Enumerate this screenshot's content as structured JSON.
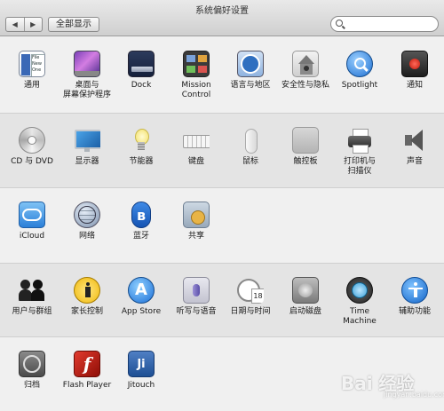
{
  "window": {
    "title": "系统偏好设置",
    "nav_back": "◀",
    "nav_forward": "▶",
    "show_all": "全部显示",
    "search_value": ""
  },
  "sections": [
    {
      "items": [
        {
          "label": "通用",
          "icon": "general-icon"
        },
        {
          "label": "桌面与\n屏幕保护程序",
          "icon": "desktop-icon"
        },
        {
          "label": "Dock",
          "icon": "dock-icon"
        },
        {
          "label": "Mission\nControl",
          "icon": "mission-control-icon"
        },
        {
          "label": "语言与地区",
          "icon": "language-icon"
        },
        {
          "label": "安全性与隐私",
          "icon": "security-icon"
        },
        {
          "label": "Spotlight",
          "icon": "spotlight-icon"
        },
        {
          "label": "通知",
          "icon": "notifications-icon"
        }
      ]
    },
    {
      "items": [
        {
          "label": "CD 与 DVD",
          "icon": "cd-icon"
        },
        {
          "label": "显示器",
          "icon": "display-icon"
        },
        {
          "label": "节能器",
          "icon": "energy-saver-icon"
        },
        {
          "label": "键盘",
          "icon": "keyboard-icon"
        },
        {
          "label": "鼠标",
          "icon": "mouse-icon"
        },
        {
          "label": "触控板",
          "icon": "trackpad-icon"
        },
        {
          "label": "打印机与\n扫描仪",
          "icon": "printer-icon"
        },
        {
          "label": "声音",
          "icon": "sound-icon"
        }
      ]
    },
    {
      "items": [
        {
          "label": "iCloud",
          "icon": "icloud-icon"
        },
        {
          "label": "网络",
          "icon": "network-icon"
        },
        {
          "label": "蓝牙",
          "icon": "bluetooth-icon"
        },
        {
          "label": "共享",
          "icon": "sharing-icon"
        }
      ]
    },
    {
      "items": [
        {
          "label": "用户与群组",
          "icon": "users-icon"
        },
        {
          "label": "家长控制",
          "icon": "parental-controls-icon"
        },
        {
          "label": "App Store",
          "icon": "app-store-icon"
        },
        {
          "label": "听写与语音",
          "icon": "dictation-icon"
        },
        {
          "label": "日期与时间",
          "icon": "date-time-icon"
        },
        {
          "label": "启动磁盘",
          "icon": "startup-disk-icon"
        },
        {
          "label": "Time Machine",
          "icon": "time-machine-icon"
        },
        {
          "label": "辅助功能",
          "icon": "accessibility-icon"
        }
      ]
    },
    {
      "items": [
        {
          "label": "归档",
          "icon": "archive-icon"
        },
        {
          "label": "Flash Player",
          "icon": "flash-player-icon"
        },
        {
          "label": "Jitouch",
          "icon": "jitouch-icon"
        }
      ]
    }
  ],
  "icon_text": {
    "date_day": "18",
    "flash_letter": "f",
    "jitouch_letters": "Ji",
    "general_lines": [
      "File",
      "New",
      "One"
    ]
  },
  "watermark": {
    "logo": "Bai 经验",
    "url": "jingyan.baidu.com"
  }
}
